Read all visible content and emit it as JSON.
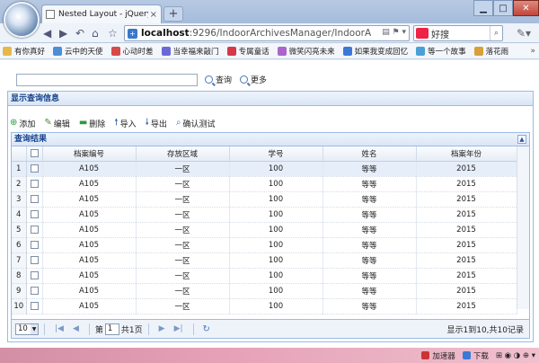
{
  "browser": {
    "tab_title": "Nested Layout - jQuery Ea",
    "tab_close": "×",
    "new_tab": "+",
    "url_host": "localhost",
    "url_path": ":9296/IndoorArchivesManager/IndoorA",
    "search_text": "好搜",
    "bookmarks": [
      {
        "label": "有你真好",
        "color": "#e6b84a"
      },
      {
        "label": "云中的天使",
        "color": "#4a8fd6"
      },
      {
        "label": "心动时差",
        "color": "#d64a4a"
      },
      {
        "label": "当幸福来敲门",
        "color": "#6a6ad6"
      },
      {
        "label": "专属童话",
        "color": "#d6384a"
      },
      {
        "label": "微笑闪亮未来",
        "color": "#aa66cc"
      },
      {
        "label": "如果我变成回忆",
        "color": "#3a7ad6"
      },
      {
        "label": "等一个故事",
        "color": "#4aa0d6"
      },
      {
        "label": "落花雨",
        "color": "#d6a03a"
      }
    ],
    "bookmarks_more": "»"
  },
  "query": {
    "search_label": "查询",
    "more_label": "更多"
  },
  "panel": {
    "title": "显示查询信息"
  },
  "toolbar": {
    "add": "添加",
    "edit": "编辑",
    "delete": "删除",
    "import": "导入",
    "export": "导出",
    "confirm_test": "确认测试"
  },
  "grid": {
    "title": "查询结果",
    "columns": [
      "档案编号",
      "存放区域",
      "学号",
      "姓名",
      "档案年份"
    ],
    "rows": [
      {
        "n": "1",
        "id": "A105",
        "area": "一区",
        "sid": "100",
        "name": "等等",
        "year": "2015"
      },
      {
        "n": "2",
        "id": "A105",
        "area": "一区",
        "sid": "100",
        "name": "等等",
        "year": "2015"
      },
      {
        "n": "3",
        "id": "A105",
        "area": "一区",
        "sid": "100",
        "name": "等等",
        "year": "2015"
      },
      {
        "n": "4",
        "id": "A105",
        "area": "一区",
        "sid": "100",
        "name": "等等",
        "year": "2015"
      },
      {
        "n": "5",
        "id": "A105",
        "area": "一区",
        "sid": "100",
        "name": "等等",
        "year": "2015"
      },
      {
        "n": "6",
        "id": "A105",
        "area": "一区",
        "sid": "100",
        "name": "等等",
        "year": "2015"
      },
      {
        "n": "7",
        "id": "A105",
        "area": "一区",
        "sid": "100",
        "name": "等等",
        "year": "2015"
      },
      {
        "n": "8",
        "id": "A105",
        "area": "一区",
        "sid": "100",
        "name": "等等",
        "year": "2015"
      },
      {
        "n": "9",
        "id": "A105",
        "area": "一区",
        "sid": "100",
        "name": "等等",
        "year": "2015"
      },
      {
        "n": "10",
        "id": "A105",
        "area": "一区",
        "sid": "100",
        "name": "等等",
        "year": "2015"
      }
    ]
  },
  "pager": {
    "page_size": "10",
    "page_prefix": "第",
    "page_value": "1",
    "page_suffix": "共1页",
    "info": "显示1到10,共10记录"
  },
  "status": {
    "accelerator": "加速器",
    "download": "下载"
  }
}
